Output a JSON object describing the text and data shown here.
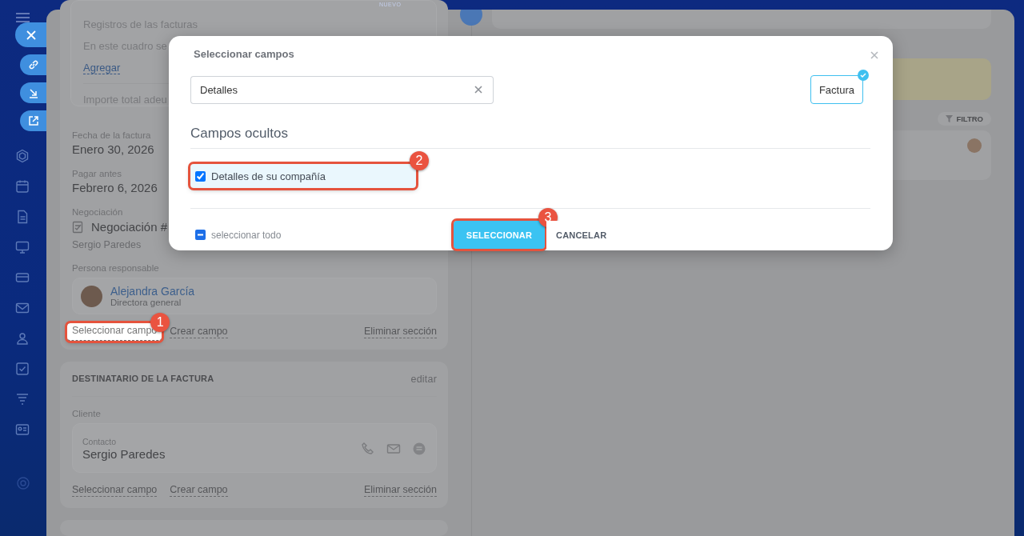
{
  "top_badge": "NUEVO",
  "invoice": {
    "records": {
      "label": "Registros de las facturas",
      "text": "En este cuadro se",
      "link": "Agregar",
      "total": "Importe total adeu"
    },
    "fields": [
      {
        "label": "Fecha de la factura",
        "value": "Enero 30, 2026"
      },
      {
        "label": "Pagar antes",
        "value": "Febrero 6, 2026"
      }
    ],
    "deal": {
      "label": "Negociación",
      "value": "Negociación #",
      "contact": "Sergio Paredes"
    },
    "responsible": {
      "label": "Persona responsable",
      "name": "Alejandra García",
      "role": "Directora general"
    },
    "actions": [
      {
        "label": "Seleccionar campo",
        "highlighted": true,
        "callout": "1"
      },
      {
        "label": "Crear campo",
        "highlighted": false
      },
      {
        "label": "Eliminar sección",
        "highlighted": false
      }
    ]
  },
  "recipient": {
    "title": "DESTINATARIO DE LA FACTURA",
    "edit": "editar",
    "client_label": "Cliente",
    "contact_label": "Contacto",
    "contact_name": "Sergio Paredes",
    "actions": [
      {
        "label": "Seleccionar campo",
        "highlighted": false
      },
      {
        "label": "Crear campo",
        "highlighted": false
      },
      {
        "label": "Eliminar sección",
        "highlighted": false
      }
    ]
  },
  "timeline": {
    "filter": "FILTRO"
  },
  "modal": {
    "title": "Seleccionar campos",
    "search_value": "Detalles",
    "entity_tag": {
      "label": "Factura",
      "selected": true
    },
    "section_title": "Campos ocultos",
    "fields": [
      {
        "label": "Detalles de su compañía",
        "checked": true,
        "highlighted": true,
        "callout": "2"
      }
    ],
    "select_all": {
      "label": "seleccionar todo",
      "indeterminate": true
    },
    "buttons": [
      {
        "label": "SELECCIONAR",
        "kind": "primary",
        "highlighted": true,
        "callout": "3"
      },
      {
        "label": "CANCELAR",
        "kind": "plain",
        "highlighted": false
      }
    ]
  }
}
